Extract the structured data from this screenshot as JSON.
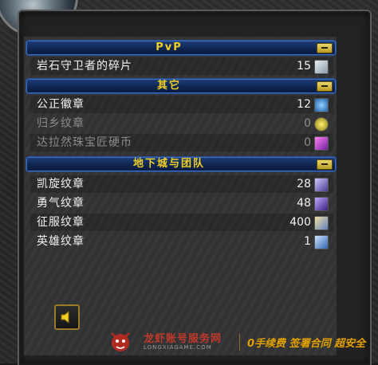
{
  "sections": [
    {
      "title": "PvP",
      "rows": [
        {
          "name": "岩石守卫者的碎片",
          "count": "15",
          "icon": "stone-shard-icon",
          "color": "#cfd8e0",
          "dim": false
        }
      ]
    },
    {
      "title": "其它",
      "rows": [
        {
          "name": "公正徽章",
          "count": "12",
          "icon": "justice-badge-icon",
          "color": "#3b8fd6",
          "dim": false
        },
        {
          "name": "归乡纹章",
          "count": "0",
          "icon": "homecoming-emblem-icon",
          "color": "#c8b820",
          "dim": true
        },
        {
          "name": "达拉然珠宝匠硬币",
          "count": "0",
          "icon": "jewelcrafter-token-icon",
          "color": "#c060d0",
          "dim": true
        }
      ]
    },
    {
      "title": "地下城与团队",
      "rows": [
        {
          "name": "凯旋纹章",
          "count": "28",
          "icon": "triumph-emblem-icon",
          "color": "#9a8ad0",
          "dim": false
        },
        {
          "name": "勇气纹章",
          "count": "48",
          "icon": "valor-emblem-icon",
          "color": "#8a6ad0",
          "dim": false
        },
        {
          "name": "征服纹章",
          "count": "400",
          "icon": "conquest-emblem-icon",
          "color": "#c0a040",
          "dim": false
        },
        {
          "name": "英雄纹章",
          "count": "1",
          "icon": "heroism-emblem-icon",
          "color": "#5a90d8",
          "dim": false
        }
      ]
    }
  ],
  "watermark": {
    "brand": "龙虾账号服务网",
    "sub": "LONGXIAGAME.COM",
    "slogan": "0手续费 签署合同 超安全"
  }
}
